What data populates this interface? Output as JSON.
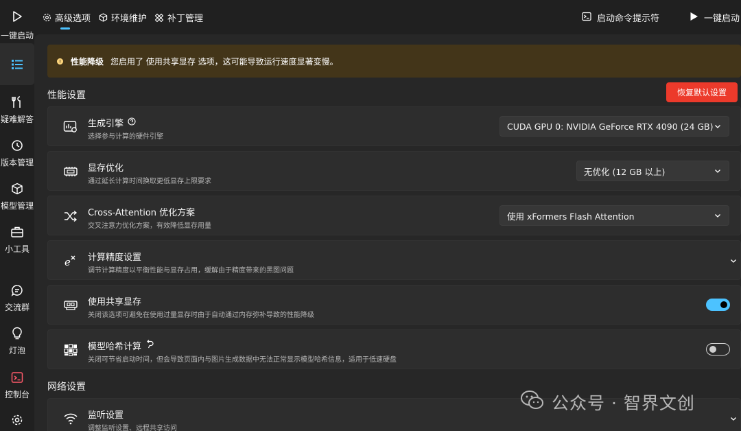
{
  "sidebar": {
    "items": [
      {
        "label": "一键启动",
        "icon": "play-icon"
      },
      {
        "label": "",
        "icon": "list-icon"
      },
      {
        "label": "疑难解答",
        "icon": "wrench-icon"
      },
      {
        "label": "版本管理",
        "icon": "history-icon"
      },
      {
        "label": "模型管理",
        "icon": "cube-icon"
      },
      {
        "label": "小工具",
        "icon": "toolbox-icon"
      },
      {
        "label": "交流群",
        "icon": "chat-icon"
      },
      {
        "label": "灯泡",
        "icon": "bulb-icon"
      },
      {
        "label": "控制台",
        "icon": "terminal-icon"
      },
      {
        "label": "",
        "icon": "gear-icon"
      }
    ]
  },
  "topbar": {
    "tabs": [
      {
        "label": "高级选项",
        "icon": "gear-icon"
      },
      {
        "label": "环境维护",
        "icon": "cube-icon"
      },
      {
        "label": "补丁管理",
        "icon": "patch-icon"
      }
    ],
    "actions": [
      {
        "label": "启动命令提示符",
        "icon": "terminal-icon"
      },
      {
        "label": "一键启动",
        "icon": "play-icon"
      }
    ]
  },
  "warning": {
    "title": "性能降级",
    "message": "您启用了 使用共享显存 选项，这可能导致运行速度显著变慢。"
  },
  "performance": {
    "section_title": "性能设置",
    "reset_label": "恢复默认设置",
    "cards": [
      {
        "title": "生成引擎",
        "desc": "选择参与计算的硬件引擎",
        "value": "CUDA GPU 0: NVIDIA GeForce RTX 4090 (24 GB)",
        "icon": "gpu-icon"
      },
      {
        "title": "显存优化",
        "desc": "通过延长计算时间换取更低显存上限要求",
        "value": "无优化 (12 GB 以上)",
        "icon": "memory-icon"
      },
      {
        "title": "Cross-Attention 优化方案",
        "desc": "交叉注意力优化方案，有效降低显存用量",
        "value": "使用 xFormers Flash Attention",
        "icon": "shuffle-icon"
      },
      {
        "title": "计算精度设置",
        "desc": "调节计算精度以平衡性能与显存占用，缓解由于精度带来的黑图问题",
        "icon": "exponent-icon"
      },
      {
        "title": "使用共享显存",
        "desc": "关闭该选项可避免在使用过量显存时由于自动通过内存弥补导致的性能降级",
        "state": "on",
        "icon": "vram-icon"
      },
      {
        "title": "模型哈希计算",
        "desc": "关闭可节省启动时间，但会导致页面内与图片生成数据中无法正常显示模型哈希信息，适用于低速硬盘",
        "state": "off",
        "icon": "hash-icon"
      }
    ]
  },
  "network": {
    "section_title": "网络设置",
    "cards": [
      {
        "title": "监听设置",
        "desc": "调整监听设置、远程共享访问",
        "icon": "wifi-icon"
      }
    ]
  },
  "watermark": {
    "text": "公众号 · 智界文创",
    "icon": "wechat-icon"
  },
  "colors": {
    "accent": "#4cc2ff",
    "danger": "#ec3a2b",
    "warning_bg": "#433519"
  }
}
